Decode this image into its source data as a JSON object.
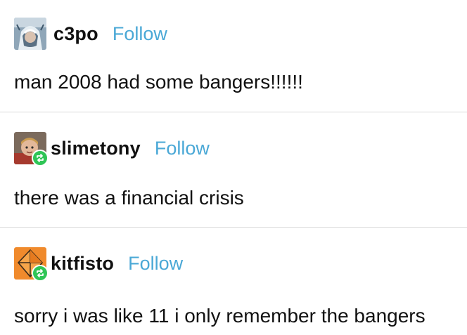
{
  "posts": [
    {
      "username": "c3po",
      "follow_label": "Follow",
      "text": "man 2008 had some bangers!!!!!!",
      "reblogged": false,
      "avatar_icon": "character-portrait-icon"
    },
    {
      "username": "slimetony",
      "follow_label": "Follow",
      "text": "there was a financial crisis",
      "reblogged": true,
      "avatar_icon": "child-portrait-icon"
    },
    {
      "username": "kitfisto",
      "follow_label": "Follow",
      "text": "sorry i was like 11 i only remember the bangers",
      "reblogged": true,
      "avatar_icon": "orange-geometric-icon"
    }
  ],
  "colors": {
    "follow": "#4aa8d6",
    "reblog_badge": "#2fc556",
    "divider": "#d8d8d8",
    "text": "#111111"
  }
}
